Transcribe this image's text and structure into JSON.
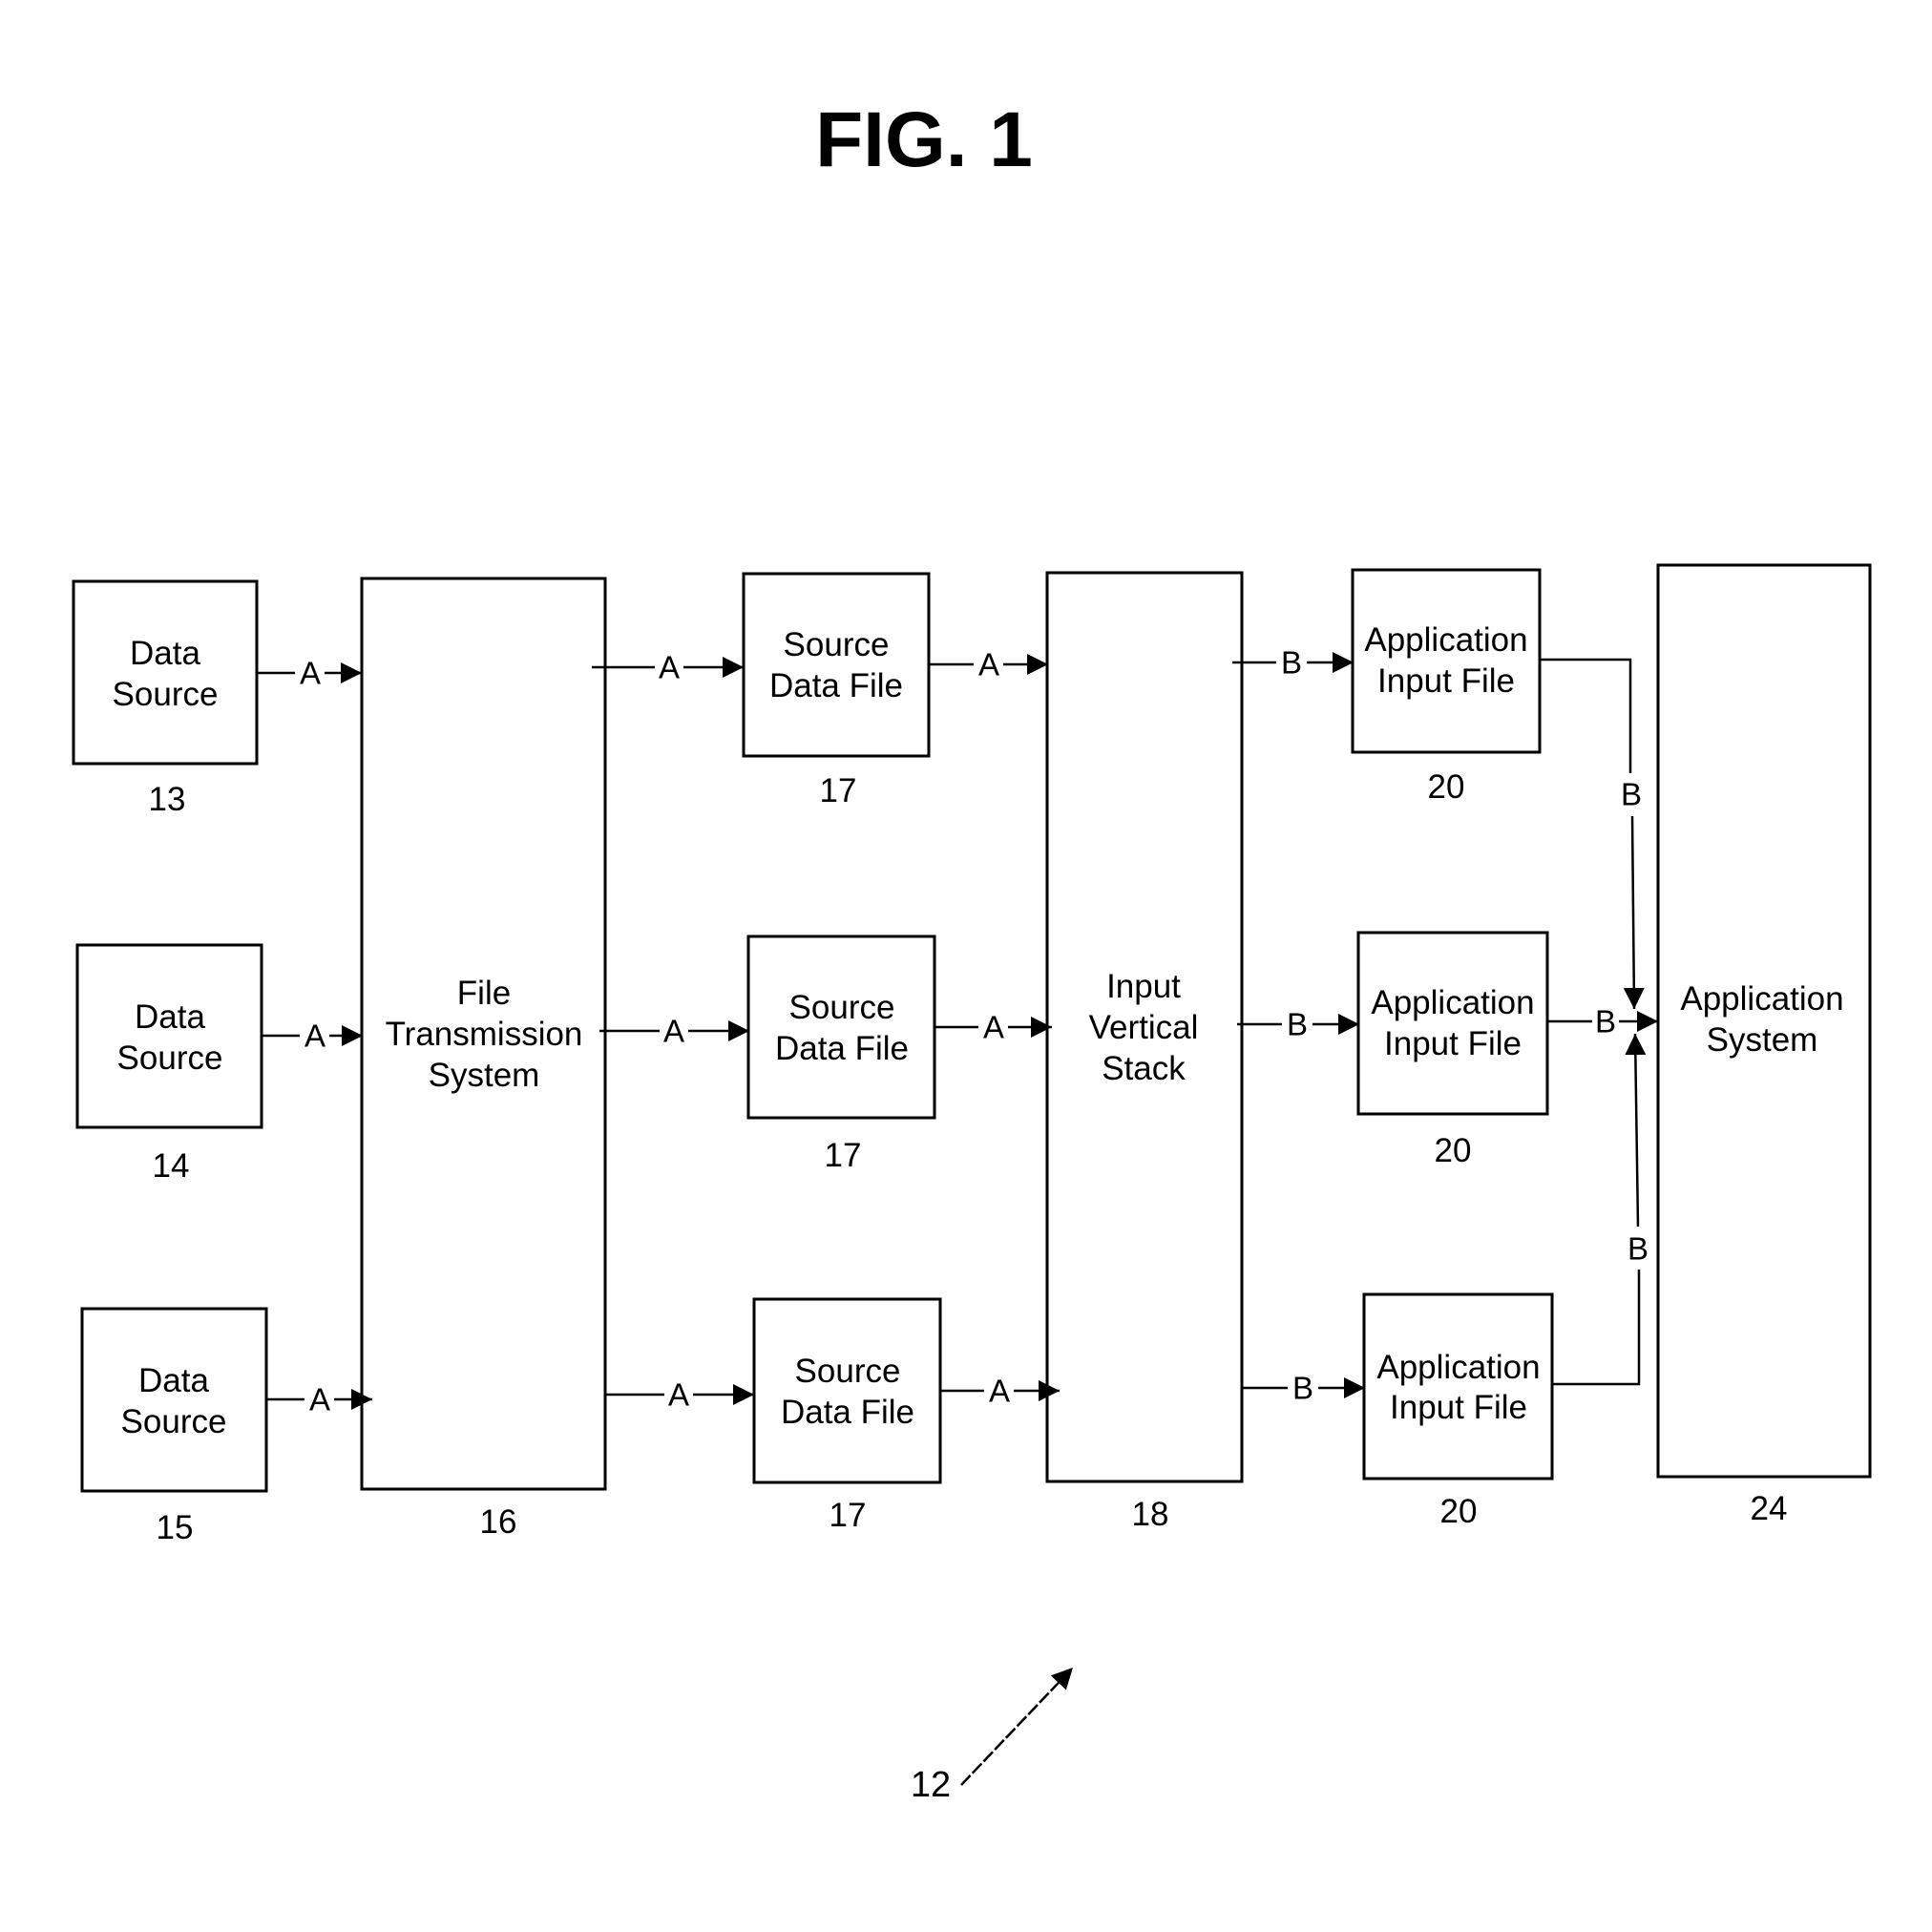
{
  "figure": {
    "title": "FIG. 1",
    "reference": "12"
  },
  "blocks": {
    "data_source_13": {
      "lines": [
        "Data",
        "Source"
      ],
      "ref": "13"
    },
    "data_source_14": {
      "lines": [
        "Data",
        "Source"
      ],
      "ref": "14"
    },
    "data_source_15": {
      "lines": [
        "Data",
        "Source"
      ],
      "ref": "15"
    },
    "file_transmission": {
      "lines": [
        "File",
        "Transmission",
        "System"
      ],
      "ref": "16"
    },
    "source_file_1": {
      "lines": [
        "Source",
        "Data File"
      ],
      "ref": "17"
    },
    "source_file_2": {
      "lines": [
        "Source",
        "Data File"
      ],
      "ref": "17"
    },
    "source_file_3": {
      "lines": [
        "Source",
        "Data File"
      ],
      "ref": "17"
    },
    "input_stack": {
      "lines": [
        "Input",
        "Vertical",
        "Stack"
      ],
      "ref": "18"
    },
    "app_input_1": {
      "lines": [
        "Application",
        "Input File"
      ],
      "ref": "20"
    },
    "app_input_2": {
      "lines": [
        "Application",
        "Input File"
      ],
      "ref": "20"
    },
    "app_input_3": {
      "lines": [
        "Application",
        "Input File"
      ],
      "ref": "20"
    },
    "app_system": {
      "lines": [
        "Application",
        "System"
      ],
      "ref": "24"
    }
  },
  "connections": {
    "ds13_fts": "A",
    "ds14_fts": "A",
    "ds15_fts": "A",
    "fts_sdf1": "A",
    "fts_sdf2": "A",
    "fts_sdf3": "A",
    "sdf1_ivs": "A",
    "sdf2_ivs": "A",
    "sdf3_ivs": "A",
    "ivs_aif1": "B",
    "ivs_aif2": "B",
    "ivs_aif3": "B",
    "aif1_as": "B",
    "aif2_as": "B",
    "aif3_as": "B"
  }
}
